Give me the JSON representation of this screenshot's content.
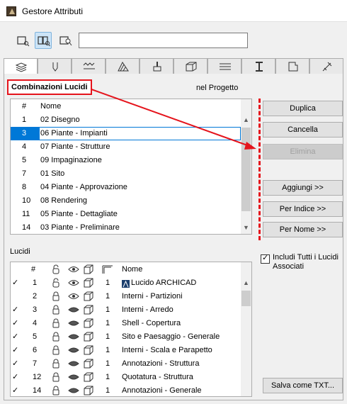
{
  "window": {
    "title": "Gestore Attributi"
  },
  "search": {
    "value": ""
  },
  "combinations": {
    "label": "Combinazioni Lucidi",
    "in_project": "nel Progetto",
    "header_num": "#",
    "header_name": "Nome",
    "rows": [
      {
        "num": "1",
        "name": "02 Disegno"
      },
      {
        "num": "3",
        "name": "06 Piante - Impianti"
      },
      {
        "num": "4",
        "name": "07 Piante - Strutture"
      },
      {
        "num": "5",
        "name": "09 Impaginazione"
      },
      {
        "num": "7",
        "name": "01 Sito"
      },
      {
        "num": "8",
        "name": "04 Piante - Approvazione"
      },
      {
        "num": "10",
        "name": "08 Rendering"
      },
      {
        "num": "11",
        "name": "05 Piante - Dettagliate"
      },
      {
        "num": "14",
        "name": "03 Piante - Preliminare"
      }
    ]
  },
  "buttons": {
    "duplicate": "Duplica",
    "delete": "Cancella",
    "eliminate": "Elimina",
    "add": "Aggiungi >>",
    "by_index": "Per Indice >>",
    "by_name": "Per Nome >>",
    "save_txt": "Salva come TXT..."
  },
  "layers": {
    "label": "Lucidi",
    "header_num": "#",
    "header_name": "Nome",
    "include_all": "Includi Tutti i Lucidi Associati",
    "rows": [
      {
        "check": "✓",
        "num": "1",
        "pen": "1",
        "name": "Lucido ARCHICAD"
      },
      {
        "check": "",
        "num": "2",
        "pen": "1",
        "name": "Interni - Partizioni"
      },
      {
        "check": "✓",
        "num": "3",
        "pen": "1",
        "name": "Interni - Arredo"
      },
      {
        "check": "✓",
        "num": "4",
        "pen": "1",
        "name": "Shell - Copertura"
      },
      {
        "check": "✓",
        "num": "5",
        "pen": "1",
        "name": "Sito e Paesaggio - Generale"
      },
      {
        "check": "✓",
        "num": "6",
        "pen": "1",
        "name": "Interni - Scala e Parapetto"
      },
      {
        "check": "✓",
        "num": "7",
        "pen": "1",
        "name": "Annotazioni - Struttura"
      },
      {
        "check": "✓",
        "num": "12",
        "pen": "1",
        "name": "Quotatura - Struttura"
      },
      {
        "check": "✓",
        "num": "14",
        "pen": "1",
        "name": "Annotazioni - Generale"
      }
    ]
  },
  "colors": {
    "annotation_red": "#e5141c",
    "selection_blue": "#0078d7"
  }
}
